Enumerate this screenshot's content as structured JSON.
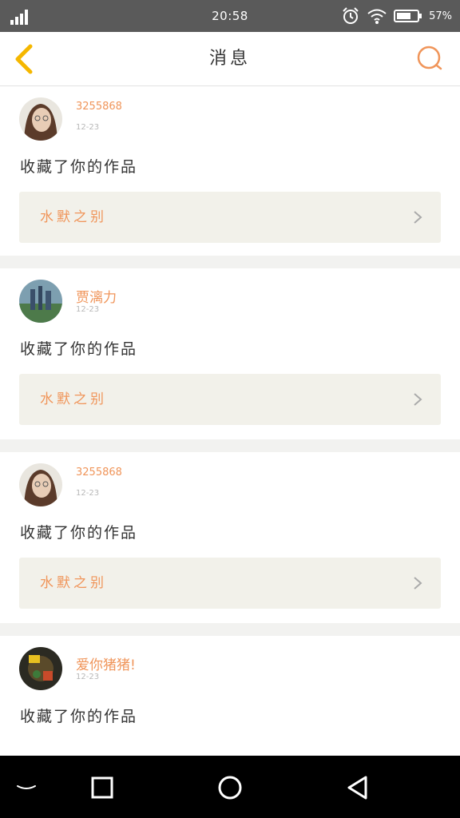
{
  "status_bar": {
    "time": "20:58",
    "battery": "57%"
  },
  "header": {
    "title": "消息"
  },
  "messages": [
    {
      "user": "3255868",
      "date": "12-23",
      "action": "收藏了你的作品",
      "work": "水默之别"
    },
    {
      "user": "贾漓力",
      "date": "12-23",
      "action": "收藏了你的作品",
      "work": "水默之别"
    },
    {
      "user": "3255868",
      "date": "12-23",
      "action": "收藏了你的作品",
      "work": "水默之别"
    },
    {
      "user": "爱你猪猪!",
      "date": "12-23",
      "action": "收藏了你的作品",
      "work": ""
    }
  ],
  "icons": {
    "back": "back-chevron-icon",
    "search": "search-icon",
    "detail": "chevron-right-icon",
    "nav": [
      "down-chevron-icon",
      "square-recents-icon",
      "circle-home-icon",
      "triangle-back-icon"
    ]
  },
  "colors": {
    "accent": "#f0955a",
    "card_bg": "#f2f1ea",
    "back": "#f5b700"
  }
}
